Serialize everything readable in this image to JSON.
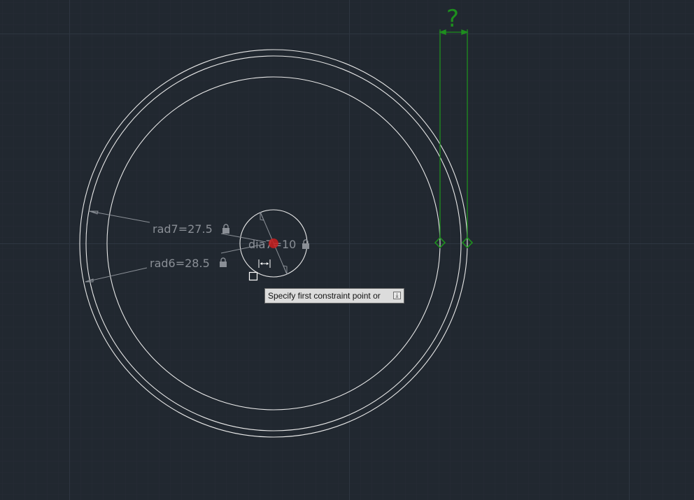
{
  "dimensions": {
    "rad7": "rad7=27.5",
    "rad6": "rad6=28.5",
    "dia": "dia7=10"
  },
  "pending_dimension": {
    "label": "?"
  },
  "tooltip": {
    "prompt": "Specify first constraint point or",
    "more_icon": "download-arrow-icon"
  },
  "icons": {
    "lock": "lock-icon",
    "cursor": "horizontal-dimension-cursor-icon",
    "snap": "grip-square-icon"
  },
  "colors": {
    "background": "#212830",
    "geometry": "#e8e8e8",
    "dimension": "#8a8f96",
    "constraint": "#1e8f1e",
    "center_marker": "#c81e1e"
  }
}
